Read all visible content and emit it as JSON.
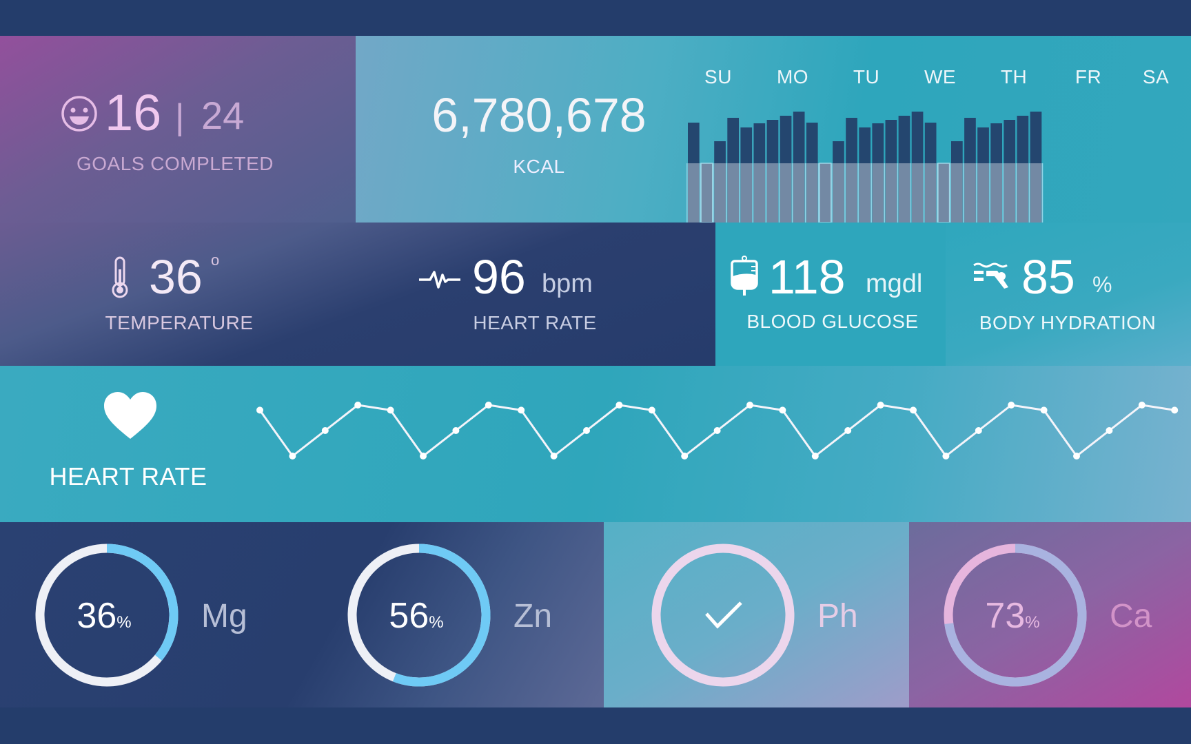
{
  "colors": {
    "background": "#243d6b",
    "teal": "#2ea6bc",
    "navy": "#2a4172",
    "purple": "#8a4f9a",
    "magenta": "#b04a9e",
    "ring_blue": "#6fcaf5",
    "ring_white": "#f0f0f5"
  },
  "goals": {
    "icon": "smiley-icon",
    "completed": "16",
    "separator": "|",
    "total": "24",
    "label": "GOALS COMPLETED"
  },
  "kcal": {
    "value": "6,780,678",
    "label": "KCAL"
  },
  "chart_data": [
    {
      "type": "bar",
      "categories": [
        "SU",
        "MO",
        "TU",
        "WE",
        "TH",
        "FR",
        "SA"
      ],
      "bars_per_day_pattern": "27 bars, repeating",
      "values": [
        59,
        0,
        32,
        66,
        52,
        58,
        63,
        69,
        75,
        59,
        0,
        32,
        66,
        52,
        58,
        63,
        69,
        75,
        59,
        0,
        32,
        66,
        52,
        58,
        63,
        69,
        75
      ],
      "title": "",
      "xlabel": "",
      "ylabel": ""
    },
    {
      "type": "line",
      "title": "",
      "values": [
        9,
        0,
        5,
        10,
        9,
        0,
        5,
        10,
        9,
        0,
        5,
        10,
        9,
        0,
        5,
        10,
        9,
        0,
        5,
        10,
        9,
        0,
        5,
        10,
        9,
        0,
        5,
        10,
        9
      ],
      "ylim": [
        0,
        10
      ]
    }
  ],
  "temperature": {
    "icon": "thermometer-icon",
    "value": "36",
    "unit": "o",
    "label": "TEMPERATURE"
  },
  "heart": {
    "icon": "pulse-icon",
    "value": "96",
    "unit": "bpm",
    "label": "HEART RATE"
  },
  "glucose": {
    "icon": "iv-bag-icon",
    "value": "118",
    "unit": "mgdl",
    "label": "BLOOD GLUCOSE"
  },
  "hydration": {
    "icon": "swimmer-icon",
    "value": "85",
    "unit": "%",
    "label": "BODY HYDRATION"
  },
  "heart_rate_chart": {
    "icon": "heart-icon",
    "label": "HEART RATE"
  },
  "minerals": [
    {
      "name": "Mg",
      "value": "36",
      "unit": "%",
      "percent": 36
    },
    {
      "name": "Zn",
      "value": "56",
      "unit": "%",
      "percent": 56
    },
    {
      "name": "Ph",
      "value": "",
      "unit": "",
      "percent": 100,
      "icon": "check-icon"
    },
    {
      "name": "Ca",
      "value": "73",
      "unit": "%",
      "percent": 73
    }
  ]
}
